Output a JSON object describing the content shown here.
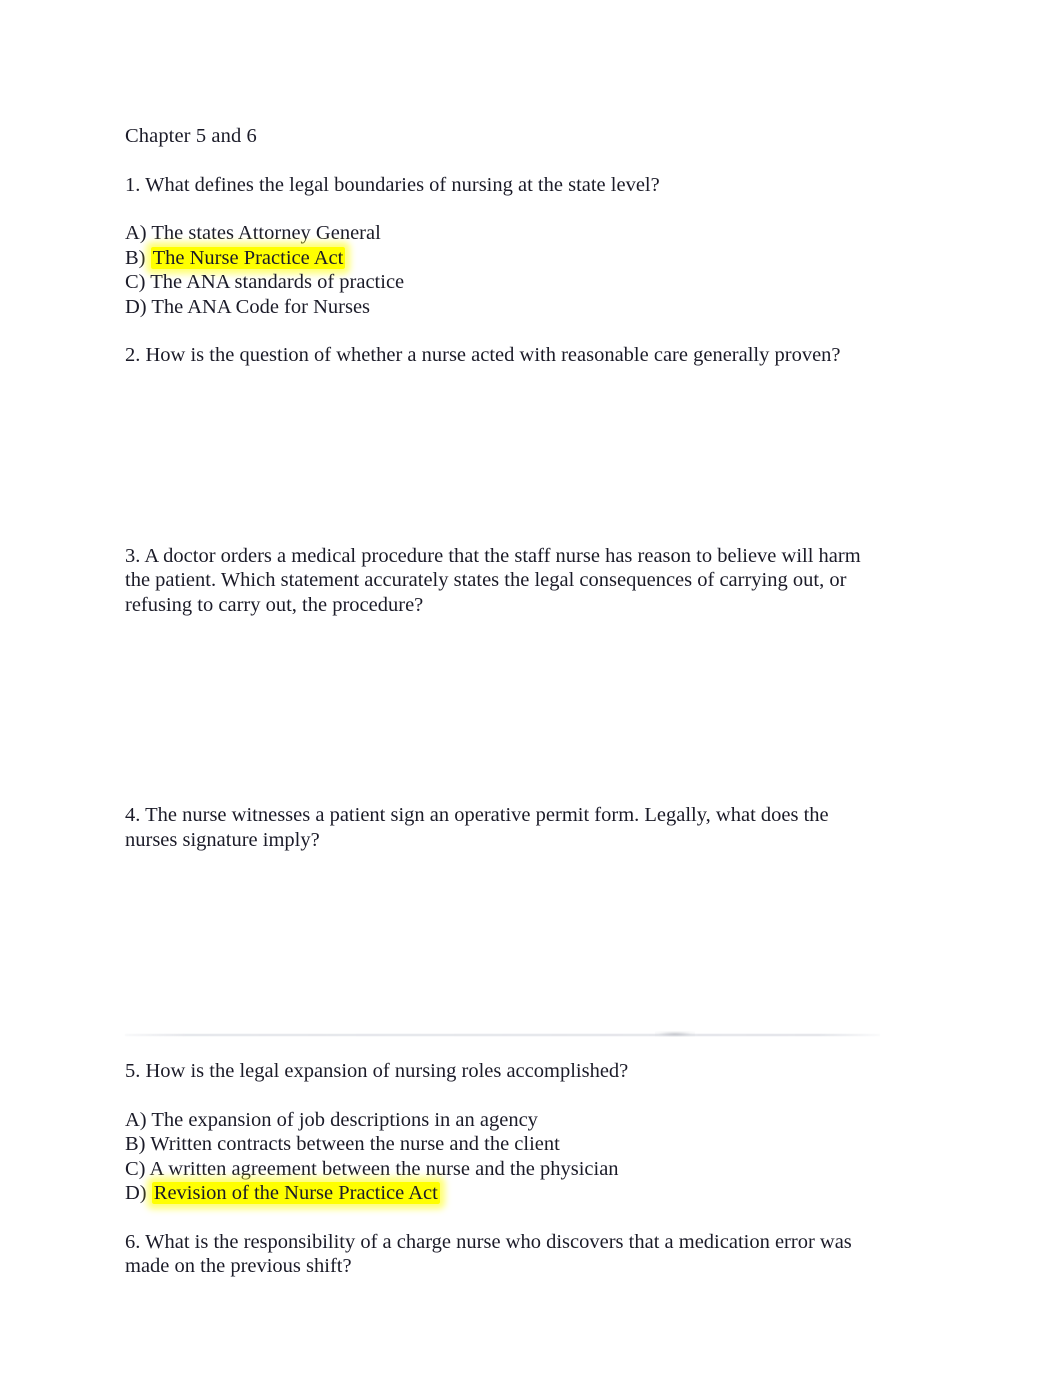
{
  "document": {
    "title": "Chapter 5 and 6",
    "highlight_color": "#ffff00",
    "text_color": "#1b1b28",
    "background_color": "#ffffff",
    "divider_color": "#dbdde3"
  },
  "questions": [
    {
      "number": "1.",
      "text": "1. What defines the legal boundaries of nursing at the state level?",
      "options": [
        {
          "label": "A) The states Attorney General",
          "highlighted": false
        },
        {
          "label": "B) ",
          "answer": "The Nurse Practice Act",
          "highlighted": true
        },
        {
          "label": "C) The ANA standards of practice",
          "highlighted": false
        },
        {
          "label": "D) The ANA Code for Nurses",
          "highlighted": false
        }
      ]
    },
    {
      "number": "2.",
      "text": "2. How is the question of whether a nurse acted with reasonable care generally proven?",
      "options": []
    },
    {
      "number": "3.",
      "text": "3. A doctor orders a medical procedure that the staff nurse has reason to believe will harm the patient. Which statement accurately states the legal consequences of carrying out, or refusing to carry out, the procedure?",
      "options": []
    },
    {
      "number": "4.",
      "text": "4. The nurse witnesses a patient sign an operative permit form. Legally, what does the nurses signature imply?",
      "options": []
    },
    {
      "number": "5.",
      "text": "5. How is the legal expansion of nursing roles accomplished?",
      "options": [
        {
          "label": "A) The expansion of job descriptions in an agency",
          "highlighted": false
        },
        {
          "label": "B) Written contracts between the nurse and the client",
          "highlighted": false
        },
        {
          "label": "C) A written agreement between the nurse and the physician",
          "highlighted": false
        },
        {
          "label": "D) ",
          "answer": "Revision of the Nurse Practice Act",
          "highlighted": true
        }
      ]
    },
    {
      "number": "6.",
      "text": "6. What is the responsibility of a charge nurse who discovers that a medication error was made on the previous shift?",
      "options": []
    }
  ]
}
